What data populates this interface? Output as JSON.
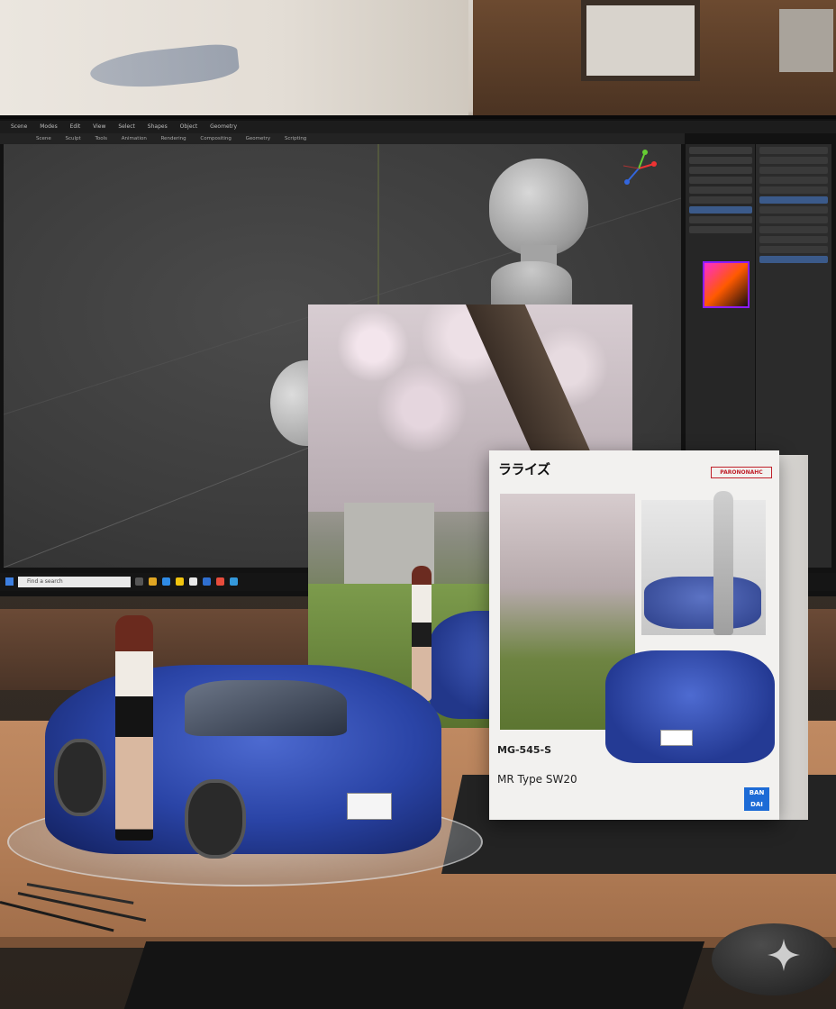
{
  "monitor": {
    "menu_items": [
      "Scene",
      "Modes",
      "Edit",
      "View",
      "Select",
      "Shapes",
      "Object",
      "Geometry"
    ],
    "toolbar_items": [
      "Scene",
      "Sculpt",
      "Tools",
      "Animation",
      "Rendering",
      "Compositing",
      "Geometry",
      "Scripting"
    ],
    "taskbar_search_placeholder": "Find a search"
  },
  "box": {
    "logo_text": "ラライズ",
    "brand_tag": "PARONONAHC",
    "model_code": "MG-545-S",
    "model_name": "MR Type SW20",
    "maker_label": "BAN DAI"
  },
  "colors": {
    "car_blue": "#2a44a6",
    "desk_wood": "#b47f58",
    "brand_red": "#c0202a",
    "maker_blue": "#1d6bd6"
  },
  "icons": [
    "axis-gizmo-icon",
    "sparkle-icon",
    "windows-start-icon"
  ]
}
